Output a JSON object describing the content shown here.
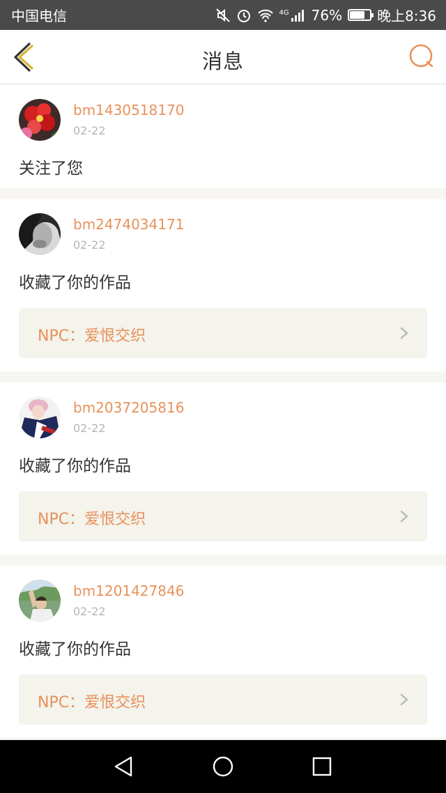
{
  "status_bar": {
    "carrier": "中国电信",
    "network": "4G",
    "battery": "76%",
    "battery_level": 0.76,
    "time": "晚上8:36"
  },
  "header": {
    "title": "消息",
    "back_icon": "chevron-left-icon",
    "search_icon": "search-icon"
  },
  "colors": {
    "accent": "#e8915a",
    "back_icon": "#d9b33a",
    "card_link_bg": "#f4f3ec",
    "page_bg": "#f7f6f2"
  },
  "messages": [
    {
      "username": "bm1430518170",
      "date": "02-22",
      "action": "关注了您"
    },
    {
      "username": "bm2474034171",
      "date": "02-22",
      "action": "收藏了你的作品",
      "work": "NPC：爱恨交织"
    },
    {
      "username": "bm2037205816",
      "date": "02-22",
      "action": "收藏了你的作品",
      "work": "NPC：爱恨交织"
    },
    {
      "username": "bm1201427846",
      "date": "02-22",
      "action": "收藏了你的作品",
      "work": "NPC：爱恨交织"
    }
  ]
}
